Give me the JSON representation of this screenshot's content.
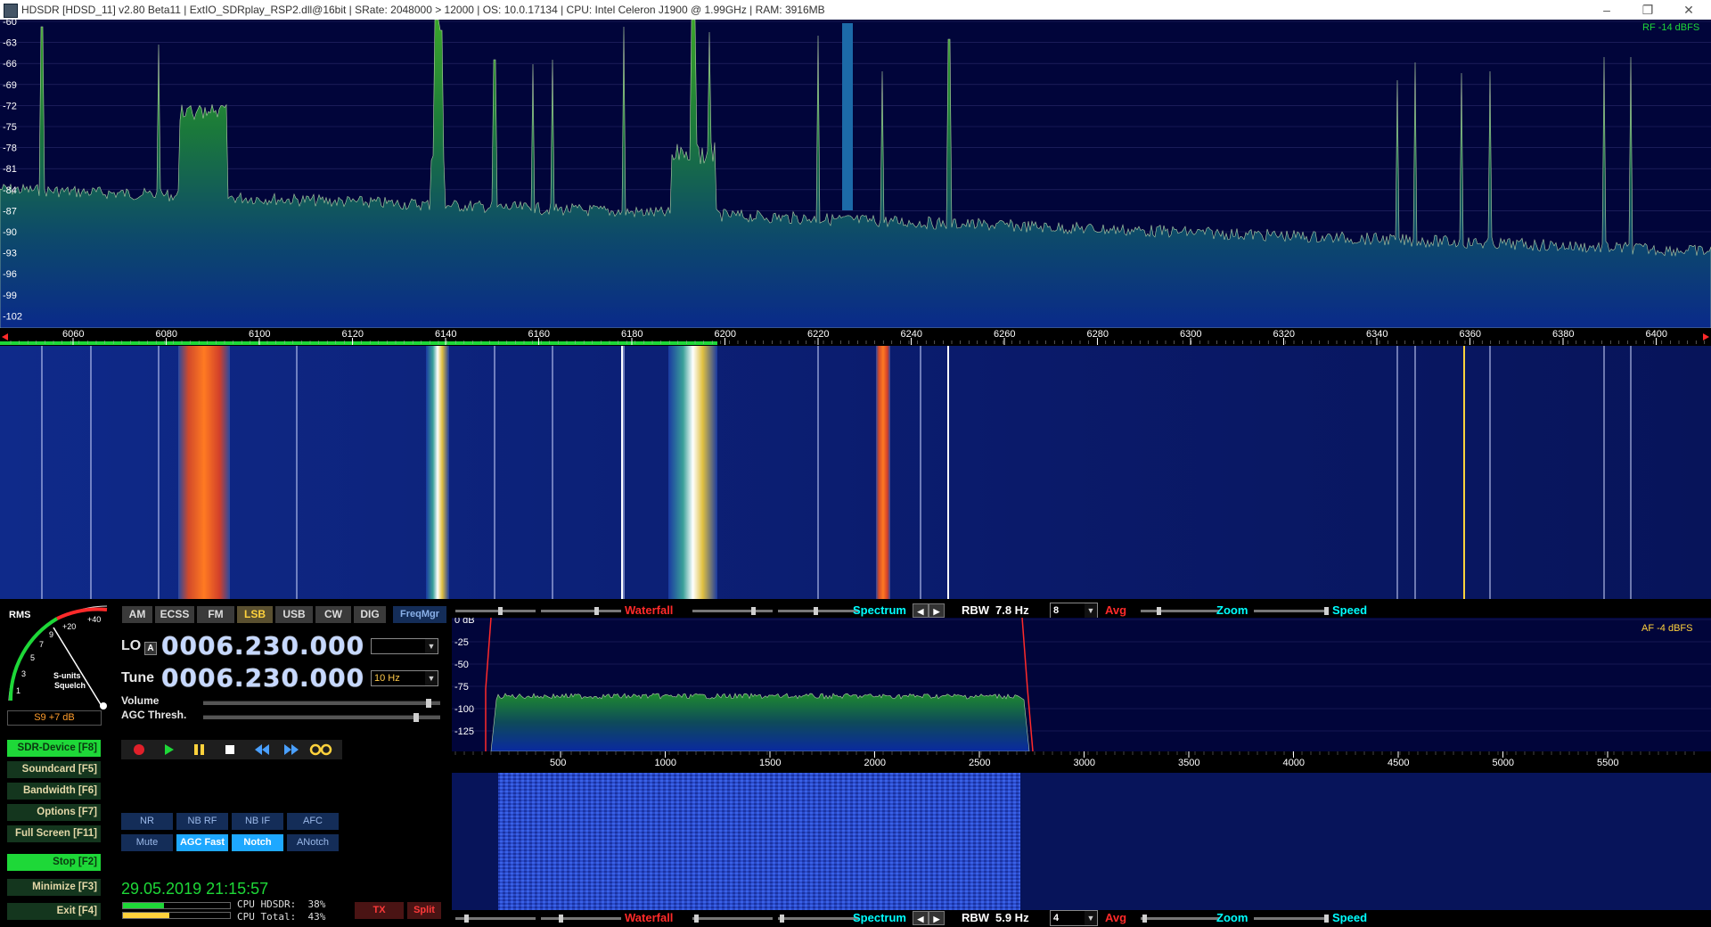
{
  "window": {
    "title": "HDSDR  [HDSD_11]  v2.80 Beta11  |  ExtIO_SDRplay_RSP2.dll@16bit  |  SRate: 2048000 > 12000  |  OS: 10.0.17134   |  CPU: Intel Celeron  J1900  @ 1.99GHz  |  RAM: 3916MB",
    "minimize": "–",
    "maximize": "❐",
    "close": "✕"
  },
  "rf_spectrum": {
    "level_label": "RF -14 dBFS",
    "db_ticks": [
      "-60",
      "-63",
      "-66",
      "-69",
      "-72",
      "-75",
      "-78",
      "-81",
      "-84",
      "-87",
      "-90",
      "-93",
      "-96",
      "-99",
      "-102"
    ],
    "freq_ticks": [
      "6060",
      "6080",
      "6100",
      "6120",
      "6140",
      "6160",
      "6180",
      "6200",
      "6220",
      "6240",
      "6260",
      "6280",
      "6300",
      "6320",
      "6340",
      "6360",
      "6380",
      "6400"
    ]
  },
  "meter": {
    "rms": "RMS",
    "scale": [
      "1",
      "3",
      "5",
      "7",
      "9",
      "+20",
      "+40"
    ],
    "caption": "S-units",
    "squelch": "Squelch",
    "readout": "S9 +7 dB"
  },
  "modes": [
    {
      "label": "AM",
      "on": false
    },
    {
      "label": "ECSS",
      "on": false
    },
    {
      "label": "FM",
      "on": false
    },
    {
      "label": "LSB",
      "on": true
    },
    {
      "label": "USB",
      "on": false
    },
    {
      "label": "CW",
      "on": false
    },
    {
      "label": "DIG",
      "on": false
    }
  ],
  "freqmgr": "FreqMgr",
  "lo": {
    "label": "LO",
    "badge": "A",
    "value": "0006.230.000"
  },
  "tune": {
    "label": "Tune",
    "value": "0006.230.000",
    "step": "10 Hz"
  },
  "volume_label": "Volume",
  "agc_label": "AGC Thresh.",
  "side_buttons": [
    {
      "label": "SDR-Device [F8]",
      "on": true
    },
    {
      "label": "Soundcard [F5]",
      "on": false
    },
    {
      "label": "Bandwidth [F6]",
      "on": false
    },
    {
      "label": "Options  [F7]",
      "on": false
    },
    {
      "label": "Full Screen [F11]",
      "on": false
    },
    {
      "label": "Stop       [F2]",
      "on": true
    },
    {
      "label": "Minimize [F3]",
      "on": false
    },
    {
      "label": "Exit       [F4]",
      "on": false
    }
  ],
  "dsp": [
    {
      "label": "NR",
      "on": false
    },
    {
      "label": "NB RF",
      "on": false
    },
    {
      "label": "NB IF",
      "on": false
    },
    {
      "label": "AFC",
      "on": false
    },
    {
      "label": "Mute",
      "on": false
    },
    {
      "label": "AGC Fast",
      "on": true
    },
    {
      "label": "Notch",
      "on": true
    },
    {
      "label": "ANotch",
      "on": false
    }
  ],
  "datetime": "29.05.2019 21:15:57",
  "cpu": {
    "hdsdr": "CPU HDSDR:  38%",
    "total": "CPU Total:  43%",
    "hdsdr_level": 0.38,
    "total_level": 0.43
  },
  "tx": "TX",
  "split": "Split",
  "top_strip": {
    "waterfall": "Waterfall",
    "spectrum": "Spectrum",
    "rbw_label": "RBW",
    "rbw": "7.8 Hz",
    "avg_value": "8",
    "avg": "Avg",
    "zoom": "Zoom",
    "speed": "Speed"
  },
  "bottom_strip": {
    "waterfall": "Waterfall",
    "spectrum": "Spectrum",
    "rbw_label": "RBW",
    "rbw": "5.9 Hz",
    "avg_value": "4",
    "avg": "Avg",
    "zoom": "Zoom",
    "speed": "Speed"
  },
  "af_spectrum": {
    "level_label": "AF  -4 dBFS",
    "db_ticks": [
      "0 dB",
      "-25",
      "-50",
      "-75",
      "-100",
      "-125"
    ],
    "freq_ticks": [
      "500",
      "1000",
      "1500",
      "2000",
      "2500",
      "3000",
      "3500",
      "4000",
      "4500",
      "5000",
      "5500"
    ]
  },
  "colors": {
    "green": "#1ed838",
    "accent": "#00ffff",
    "red": "#ff2a2a",
    "yellow": "#ffd23c"
  }
}
